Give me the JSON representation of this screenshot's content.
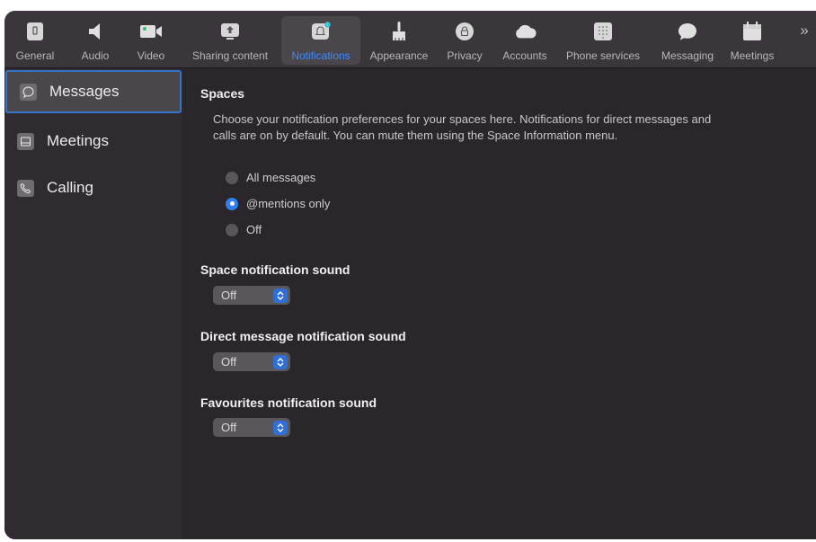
{
  "toolbar": {
    "items": [
      {
        "label": "General",
        "icon": "general-icon"
      },
      {
        "label": "Audio",
        "icon": "speaker-icon"
      },
      {
        "label": "Video",
        "icon": "video-camera-icon"
      },
      {
        "label": "Sharing content",
        "icon": "share-screen-icon"
      },
      {
        "label": "Notifications",
        "icon": "bell-icon",
        "active": true
      },
      {
        "label": "Appearance",
        "icon": "brush-icon"
      },
      {
        "label": "Privacy",
        "icon": "lock-icon"
      },
      {
        "label": "Accounts",
        "icon": "cloud-icon"
      },
      {
        "label": "Phone services",
        "icon": "dialpad-icon"
      },
      {
        "label": "Messaging",
        "icon": "chat-bubble-icon"
      },
      {
        "label": "Meetings",
        "icon": "calendar-icon"
      }
    ],
    "more_glyph": "»"
  },
  "sidebar": {
    "items": [
      {
        "label": "Messages",
        "icon": "message-icon",
        "active": true
      },
      {
        "label": "Meetings",
        "icon": "meetings-icon"
      },
      {
        "label": "Calling",
        "icon": "phone-icon"
      }
    ]
  },
  "spaces": {
    "title": "Spaces",
    "description": "Choose your notification preferences for your spaces here. Notifications for direct messages and calls are on by default. You can mute them using the Space Information menu.",
    "options": [
      {
        "label": "All messages",
        "selected": false
      },
      {
        "label": "@mentions only",
        "selected": true
      },
      {
        "label": "Off",
        "selected": false
      }
    ]
  },
  "space_sound": {
    "title": "Space notification sound",
    "value": "Off"
  },
  "direct_sound": {
    "title": "Direct message notification sound",
    "value": "Off"
  },
  "favourites_sound": {
    "title": "Favourites notification sound",
    "value": "Off"
  },
  "colors": {
    "accent": "#3d8bff",
    "radio_checked": "#2f7ff0",
    "select_button": "#2f6fd6",
    "active_border": "#3574c8"
  }
}
